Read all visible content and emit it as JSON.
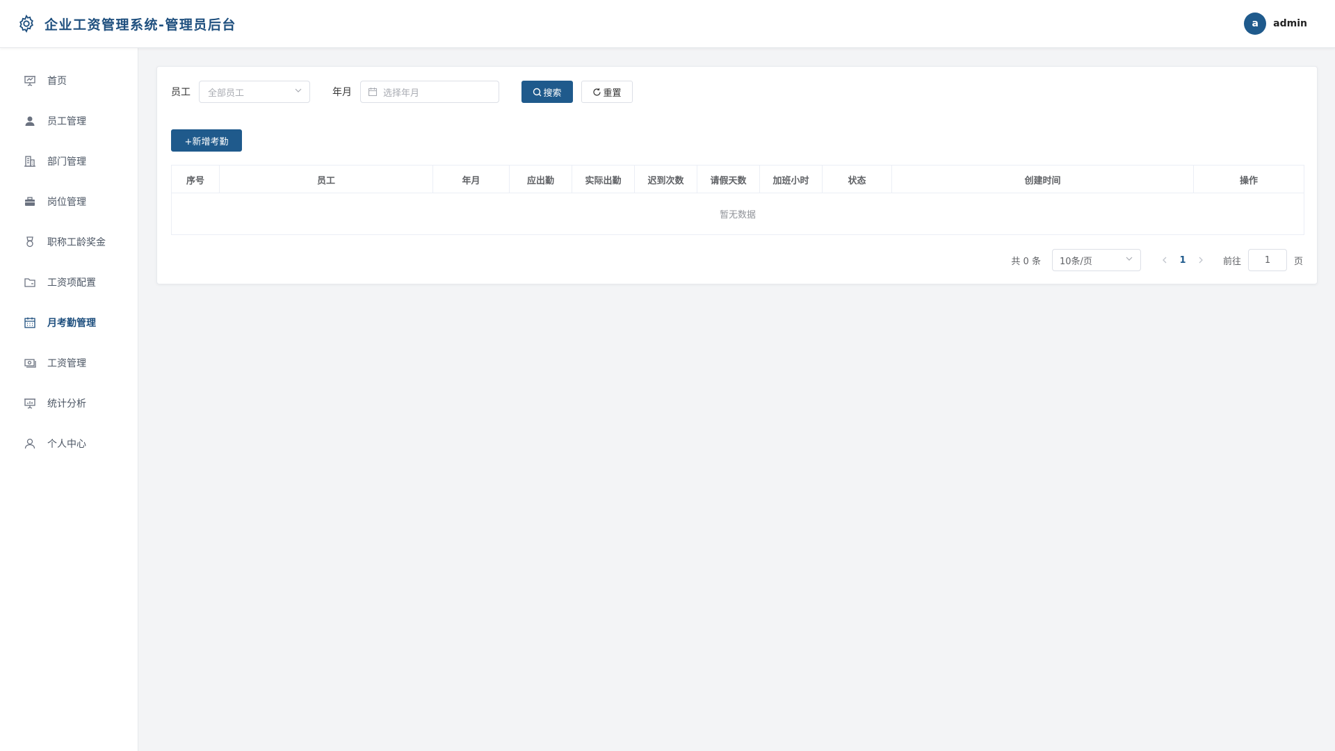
{
  "header": {
    "title": "企业工资管理系统-管理员后台",
    "user": {
      "avatar_letter": "a",
      "name": "admin"
    }
  },
  "sidebar": {
    "items": [
      {
        "label": "首页",
        "icon": "presentation-icon",
        "active": false
      },
      {
        "label": "员工管理",
        "icon": "user-filled-icon",
        "active": false
      },
      {
        "label": "部门管理",
        "icon": "office-building-icon",
        "active": false
      },
      {
        "label": "岗位管理",
        "icon": "suitcase-icon",
        "active": false
      },
      {
        "label": "职称工龄奖金",
        "icon": "medal-icon",
        "active": false
      },
      {
        "label": "工资项配置",
        "icon": "folder-icon",
        "active": false
      },
      {
        "label": "月考勤管理",
        "icon": "calendar-icon",
        "active": true
      },
      {
        "label": "工资管理",
        "icon": "money-icon",
        "active": false
      },
      {
        "label": "统计分析",
        "icon": "data-analysis-icon",
        "active": false
      },
      {
        "label": "个人中心",
        "icon": "user-icon",
        "active": false
      }
    ]
  },
  "filters": {
    "employee_label": "员工",
    "employee_placeholder": "全部员工",
    "month_label": "年月",
    "month_placeholder": "选择年月",
    "search_label": "搜索",
    "reset_label": "重置"
  },
  "toolbar": {
    "add_label": "+新增考勤"
  },
  "table": {
    "columns": [
      "序号",
      "员工",
      "年月",
      "应出勤",
      "实际出勤",
      "迟到次数",
      "请假天数",
      "加班小时",
      "状态",
      "创建时间",
      "操作"
    ],
    "empty_text": "暂无数据"
  },
  "pagination": {
    "total_text": "共 0 条",
    "page_size": "10条/页",
    "current_page": "1",
    "goto_label": "前往",
    "goto_value": "1",
    "page_suffix": "页"
  },
  "colors": {
    "primary": "#1f5a8c",
    "title": "#1e4f7e",
    "background": "#f3f4f6"
  }
}
